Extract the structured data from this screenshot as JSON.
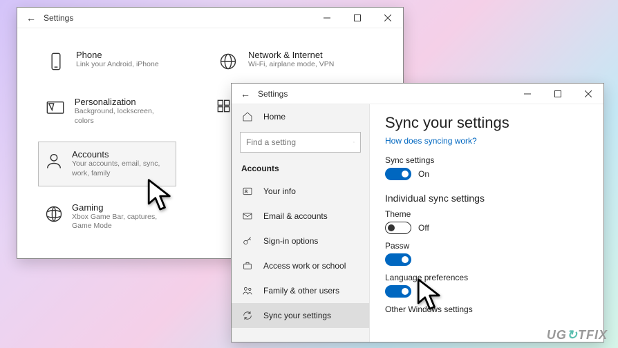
{
  "window1": {
    "title": "Settings",
    "categories": {
      "phone": {
        "title": "Phone",
        "desc": "Link your Android, iPhone"
      },
      "network": {
        "title": "Network & Internet",
        "desc": "Wi-Fi, airplane mode, VPN"
      },
      "personalization": {
        "title": "Personalization",
        "desc": "Background, lockscreen, colors"
      },
      "apps_partial": {
        "title": "",
        "desc": ""
      },
      "accounts": {
        "title": "Accounts",
        "desc": "Your accounts, email, sync, work, family"
      },
      "gaming": {
        "title": "Gaming",
        "desc": "Xbox Game Bar, captures, Game Mode"
      }
    }
  },
  "window2": {
    "title": "Settings",
    "sidebar": {
      "home": "Home",
      "search_placeholder": "Find a setting",
      "section": "Accounts",
      "items": {
        "your_info": "Your info",
        "email": "Email & accounts",
        "signin": "Sign-in options",
        "work": "Access work or school",
        "family": "Family & other users",
        "sync": "Sync your settings"
      }
    },
    "content": {
      "heading": "Sync your settings",
      "link": "How does syncing work?",
      "sync_label": "Sync settings",
      "sync_state": "On",
      "section2": "Individual sync settings",
      "theme_label": "Theme",
      "theme_state": "Off",
      "pass_label": "Passw",
      "lang_label": "Language preferences",
      "lang_state": "On",
      "other_label": "Other Windows settings"
    }
  },
  "watermark": "UG TFIX"
}
